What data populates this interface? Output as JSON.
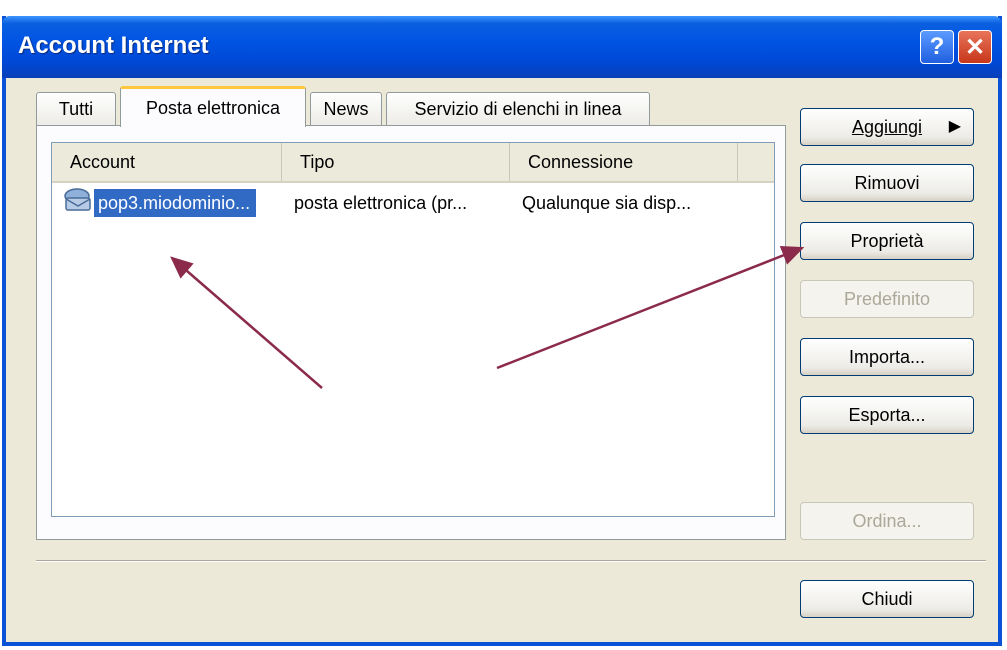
{
  "window": {
    "title": "Account Internet",
    "help_label": "?",
    "close_label": "✕"
  },
  "tabs": [
    {
      "label": "Tutti",
      "active": false
    },
    {
      "label": "Posta elettronica",
      "active": true
    },
    {
      "label": "News",
      "active": false
    },
    {
      "label": "Servizio di elenchi in linea",
      "active": false
    }
  ],
  "list": {
    "columns": [
      "Account",
      "Tipo",
      "Connessione"
    ],
    "rows": [
      {
        "account": "pop3.miodominio...",
        "tipo": "posta elettronica (pr...",
        "connessione": "Qualunque sia disp...",
        "icon": "mail-account-icon",
        "selected": true
      }
    ]
  },
  "buttons": {
    "aggiungi": "Aggiungi",
    "rimuovi": "Rimuovi",
    "proprieta": "Proprietà",
    "predefinito": "Predefinito",
    "importa": "Importa...",
    "esporta": "Esporta...",
    "ordina": "Ordina...",
    "chiudi": "Chiudi"
  },
  "colors": {
    "titlebar": "#0054e3",
    "selection": "#316ac5",
    "annotation_arrow": "#8b2a4a"
  }
}
